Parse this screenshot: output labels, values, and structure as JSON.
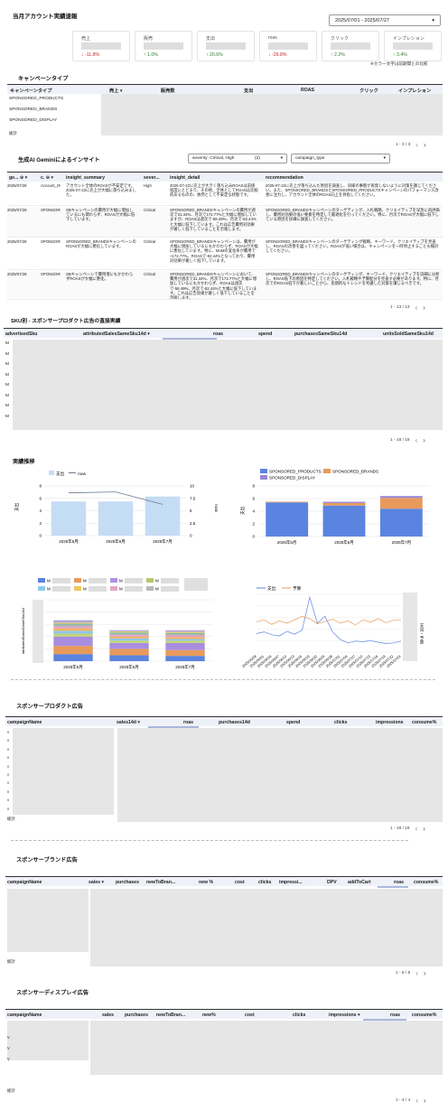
{
  "header": {
    "title": "当月アカウント実績速報",
    "date_range": "2025/07/01 - 2025/07/27",
    "note": "※カラー文字は前期間との比較"
  },
  "kpis": [
    {
      "label": "売上",
      "delta": "↓ -11.8%",
      "trend": "down"
    },
    {
      "label": "販売",
      "delta": "↑ 1.0%",
      "trend": "up"
    },
    {
      "label": "支出",
      "delta": "↑ 20.6%",
      "trend": "up"
    },
    {
      "label": "roas",
      "delta": "↓ -26.8%",
      "trend": "down"
    },
    {
      "label": "クリック",
      "delta": "↑ 2.2%",
      "trend": "up"
    },
    {
      "label": "インプレション",
      "delta": "↑ 3.4%",
      "trend": "up"
    }
  ],
  "campaign_type": {
    "title": "キャンペーンタイプ",
    "columns": [
      "キャンペーンタイプ",
      "売上 ▾",
      "販売数",
      "支出",
      "ROAS",
      "クリック",
      "インプレション"
    ],
    "rows": [
      "SPONSORED_PRODUCTS",
      "SPONSORED_BRANDS",
      "SPONSORED_DISPLAY"
    ],
    "total_label": "総計",
    "pager": "1 - 3 / 3"
  },
  "insights": {
    "title": "生成AI Geminiによるインサイト",
    "severity_filter": "severity: Critical, High",
    "severity_count": "(2)",
    "campaign_type_filter": "campaign_type",
    "columns": [
      "ge... ⊕ ▾",
      "c. ⊕ ▾",
      "insight_summary",
      "sever...",
      "insight_detail",
      "recommendation"
    ],
    "rows": [
      {
        "date": "2025/07/28",
        "ctype": "Account_Overall",
        "summary": "アカウント全体のROASが不安定です。2025-07-22に売上が大幅に落ち込みました。",
        "severity": "High",
        "detail": "2025-07-22に売上が大きく落ち込みROASは前値程度にとどまり、その他、全体としてROASは比較的あるものの、依然として不安定な状態です。",
        "rec": "2025-07-22に売上が落ち込んだ原因を調査し、同様の事態が再発しないように対策を講じてください。また、SPONSORED_BRANDSとSPONSORED_PRODUCTSキャンペーンのパフォーマンス改善に注力し、アカウント全体のROAS向上を目指してください。"
      },
      {
        "date": "2025/07/28",
        "ctype": "SPONSORED_BRANDS",
        "summary": "SBキャンペーンの費用が大幅に増加しているにも関わらず、ROASが大幅に低下しています。",
        "severity": "Critical",
        "detail": "SPONSORED_BRANDSキャンペーンの費用が週次で31.34%、月次で172.77%と大幅に増加していますが、ROASは週次で-58.49%、月次で-82.44%と大幅に低下しています。これは広告費用対効果が著しく低下していることを示唆します。",
        "rec": "SPONSORED_BRANDSキャンペーンのターゲティング、入札戦略、クリエイティブを早急に再評価し、費用対効果の低い要素を特定して最適化を行ってください。特に、月次でROASが大幅に低下している原因を詳細に調査してください。"
      },
      {
        "date": "2025/07/28",
        "ctype": "SPONSORED_BRANDS",
        "summary": "SPONSORED_BRANDSキャンペーンのROASが大幅に悪化しています。",
        "severity": "Critical",
        "detail": "SPONSORED_BRANDSキャンペーンは、費用が大幅に増加しているにもかかわらず、ROASが大幅に悪化しています。特に、MoMの変化率が費用で+172.77%、ROASで-82.44%となっており、費用対効果が著しく低下しています。",
        "rec": "SPONSORED_BRANDSキャンペーンのターゲティング戦略、キーワード、クリエイティブを見直し、ROASの改善を図ってください。ROASが低い場合は、キャンペーンを一時停止することも検討してください。"
      },
      {
        "date": "2025/07/28",
        "ctype": "SPONSORED_BRANDS",
        "summary": "SBキャンペーンで費用増にもかかわらずROASが大幅に悪化。",
        "severity": "Critical",
        "detail": "SPONSORED_BRANDSキャンペーンにおいて、費用が週次で31.34%、月次で172.77%と大幅に増加しているにもかかわらず、ROASは週次で-58.49%、月次で-82.44%と大幅に低下しています。これは広告効果が著しく低下していることを示唆します。",
        "rec": "SPONSORED_BRANDSキャンペーンのターゲティング、キーワード、クリエイティブを詳細に分析し、ROAS低下の原因を特定してください。入札戦略や予算配分を見直す必要があります。特に、月次でのROAS低下が著しいことから、長期的なトレンドを考慮した対策を講じるべきです。"
      }
    ],
    "pager": "1 - 13 / 13"
  },
  "sku": {
    "title": "SKU別 - スポンサープロダクト広告の直接実績",
    "columns": [
      "advertisedSku",
      "attributedSalesSameSku14d ▾",
      "roas",
      "spend",
      "purchasesSameSku14d",
      "unitsSoldSameSku14d"
    ],
    "row_initial": "M",
    "pager": "1 - 18 / 18"
  },
  "trend": {
    "title": "実績推移",
    "legend_spend": "支出",
    "legend_roas": "roas",
    "legend_products": "SPONSORED_PRODUCTS",
    "legend_brands": "SPONSORED_BRANDS",
    "legend_display": "SPONSORED_DISPLAY",
    "axis_left": "支出",
    "axis_right": "roas",
    "axis_left2": "支出",
    "axis_sku": "attributedSalesSameSku14d",
    "legend_budget_spend": "支出",
    "legend_budget": "予算",
    "axis_budget": "支出・予算",
    "sku_legend_label": "M"
  },
  "chart_data": [
    {
      "type": "bar",
      "title": "",
      "categories": [
        "2025年5月",
        "2025年6月",
        "2025年7月"
      ],
      "series": [
        {
          "name": "支出",
          "values": [
            5.5,
            5.5,
            6.3
          ]
        },
        {
          "name": "roas",
          "values": [
            8.6,
            8.8,
            6.3
          ]
        }
      ],
      "ylim": [
        0,
        8
      ],
      "y2lim": [
        0,
        10
      ],
      "yticks": [
        "0",
        "2",
        "4",
        "6",
        "8"
      ],
      "y2ticks": [
        "0",
        "2.5",
        "5",
        "7.5",
        "10"
      ],
      "colors": {
        "bar": "#c5dcf5",
        "line": "#6a7a8c"
      }
    },
    {
      "type": "bar",
      "stacked": true,
      "categories": [
        "2025年5月",
        "2025年6月",
        "2025年7月"
      ],
      "series": [
        {
          "name": "SPONSORED_PRODUCTS",
          "values": [
            5.4,
            4.9,
            4.4
          ]
        },
        {
          "name": "SPONSORED_BRANDS",
          "values": [
            0.1,
            0.4,
            1.7
          ]
        },
        {
          "name": "SPONSORED_DISPLAY",
          "values": [
            0.0,
            0.2,
            0.3
          ]
        }
      ],
      "ylim": [
        0,
        8
      ],
      "yticks": [
        "0",
        "2",
        "4",
        "6",
        "8"
      ],
      "colors": [
        "#5a84e0",
        "#e89a5b",
        "#9b86d6"
      ]
    },
    {
      "type": "bar",
      "stacked": true,
      "categories": [
        "2025年5月",
        "2025年6月",
        "2025年7月"
      ],
      "segments": [
        [
          12,
          10,
          9
        ],
        [
          14,
          11,
          10
        ],
        [
          16,
          10,
          12
        ],
        [
          5,
          4,
          4
        ],
        [
          5,
          4,
          3
        ],
        [
          4,
          3,
          3
        ],
        [
          3,
          3,
          3
        ],
        [
          3,
          2,
          2
        ],
        [
          2,
          2,
          2
        ],
        [
          2,
          2,
          2
        ],
        [
          2,
          1,
          2
        ],
        [
          2,
          1,
          1
        ]
      ],
      "colors": [
        "#5a84e0",
        "#e89a5b",
        "#a98ee0",
        "#c3d47a",
        "#8fc7e6",
        "#f0b35d",
        "#e6a3c7",
        "#b0b0b0",
        "#7fb8a3",
        "#d8cf6a",
        "#c99ad8",
        "#9fa9d6"
      ],
      "legend_colors": [
        "#5a84e0",
        "#e89a5b",
        "#b18fe0",
        "#b7c86c",
        "#8ccbe8",
        "#eec95e",
        "#e3a5c9",
        "#b8b8b8"
      ]
    },
    {
      "type": "line",
      "x": [
        "2025/05/28",
        "2025/06/01",
        "2025/06/04",
        "2025/06/07",
        "2025/06/10",
        "2025/06/13",
        "2025/06/16",
        "2025/06/19",
        "2025/06/22",
        "2025/06/25",
        "2025/06/28",
        "2025/07/01",
        "2025/07/04",
        "2025/07/07",
        "2025/07/10",
        "2025/07/13",
        "2025/07/16",
        "2025/07/19",
        "2025/07/22",
        "2025/07/24"
      ],
      "xticks": [
        "2025/05/28",
        "2025/06/01",
        "2025/06/04",
        "2025/06/07",
        "2025/06/10",
        "2025/06/13",
        "2025/06/16",
        "2025/06/19",
        "2025/06/22",
        "2025/06/25",
        "2025/06/28",
        "2025/07/01",
        "2025/07/04",
        "2025/07/07",
        "2025/07/10",
        "2025/07/13",
        "2025/07/16",
        "2025/07/19",
        "2025/07/22",
        "2025/07/24"
      ],
      "series": [
        {
          "name": "支出",
          "values": [
            3.2,
            3.5,
            3.0,
            2.8,
            3.6,
            3.1,
            3.8,
            9.5,
            5.0,
            6.2,
            3.5,
            2.2,
            1.6,
            1.9,
            1.8,
            2.0,
            1.7,
            1.5,
            1.6,
            1.9
          ]
        },
        {
          "name": "予算",
          "values": [
            5.2,
            5.6,
            4.8,
            5.4,
            5.0,
            5.6,
            6.2,
            5.8,
            4.9,
            5.3,
            5.7,
            5.0,
            5.4,
            4.7,
            5.6,
            5.2,
            5.8,
            5.1,
            5.5,
            5.6
          ]
        }
      ],
      "colors": [
        "#5a84e0",
        "#e89a5b"
      ]
    }
  ],
  "sp_ads": {
    "title": "スポンサープロダクト広告",
    "columns": [
      "campaignName",
      "sales14d ▾",
      "roas",
      "purchases14d",
      "spend",
      "clicks",
      "impressions",
      "consume%"
    ],
    "row_initial": "v",
    "total_label": "総計",
    "pager": "1 - 18 / 18"
  },
  "sb_ads": {
    "title": "スポンサーブランド広告",
    "columns": [
      "campaignName",
      "sales ▾",
      "purchases",
      "newToBran...",
      "new %",
      "cost",
      "clicks",
      "impressi...",
      "DPV",
      "addToCart",
      "roas",
      "consume%"
    ],
    "total_label": "総計",
    "pager": "1 - 5 / 5"
  },
  "sd_ads": {
    "title": "スポンサーディスプレイ広告",
    "columns": [
      "campaignName",
      "sales",
      "purchases",
      "newToBran...",
      "new%",
      "cost",
      "clicks",
      "impressions ▾",
      "roas",
      "consume%"
    ],
    "row_initial": "V",
    "total_label": "総計",
    "pager": "1 - 4 / 4"
  },
  "icons": {
    "prev": "‹",
    "next": "›",
    "dropdown": "▾"
  }
}
